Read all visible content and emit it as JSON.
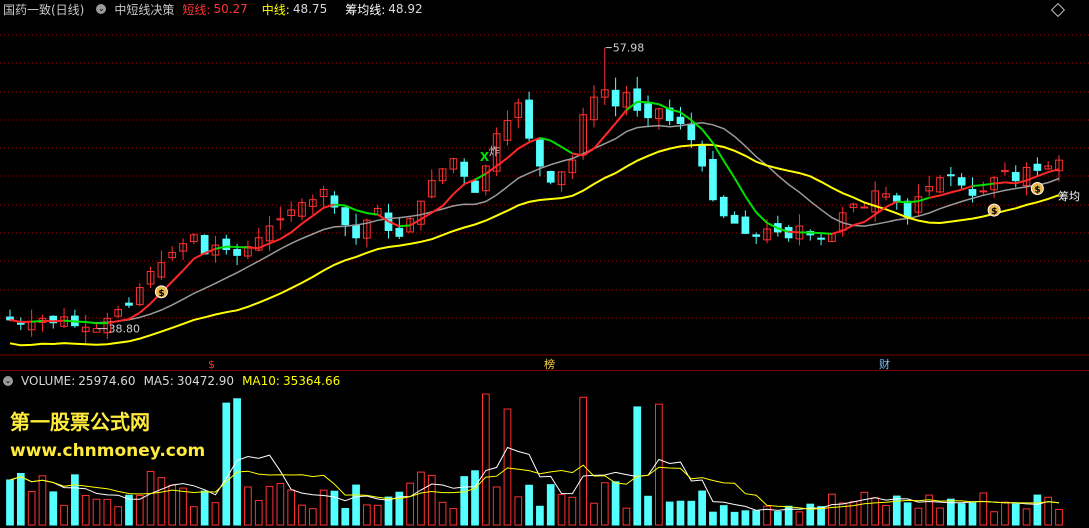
{
  "main_header": {
    "stock": "国药一致(日线)",
    "indicator": "中短线决策",
    "short_label": "短线:",
    "short_value": "50.27",
    "mid_label": "中线:",
    "mid_value": "48.75",
    "chip_label": "筹均线:",
    "chip_value": "48.92"
  },
  "annotations": {
    "high": "57.98",
    "low": "38.80",
    "chip_tag": "筹均",
    "bomb": "炸",
    "cross": "X"
  },
  "bottom_markers": [
    {
      "text": "$",
      "color": "#ff3030"
    },
    {
      "text": "榜",
      "color": "#ffd23c"
    },
    {
      "text": "财",
      "color": "#7ec8ff"
    }
  ],
  "vol_header": {
    "volume_label": "VOLUME:",
    "volume_value": "25974.60",
    "ma5_label": "MA5:",
    "ma5_value": "30472.90",
    "ma10_label": "MA10:",
    "ma10_value": "35364.66"
  },
  "watermark": {
    "title": "第一股票公式网",
    "url": "www.chnmoney.com"
  },
  "colors": {
    "up": "#ff3232",
    "down": "#54ffff",
    "short_line": "#ff2828",
    "mid_line": "#00e000",
    "chip_line": "#ffff00",
    "gray_line": "#9a9a9a",
    "grid": "#a00000"
  },
  "chart_data": {
    "type": "candlestick",
    "ylim": [
      37,
      60
    ],
    "high_label": 57.98,
    "low_label": 38.8,
    "close": [
      39.4,
      39.1,
      39.3,
      39.5,
      39.2,
      39.6,
      39.0,
      38.9,
      38.8,
      39.5,
      40.1,
      40.4,
      41.6,
      42.7,
      43.3,
      44.0,
      44.6,
      45.2,
      43.9,
      44.5,
      44.2,
      43.8,
      44.4,
      45.0,
      45.8,
      46.3,
      46.9,
      47.4,
      47.6,
      48.3,
      47.1,
      45.9,
      45.0,
      46.2,
      47.0,
      45.5,
      45.1,
      46.3,
      47.5,
      48.9,
      49.7,
      50.4,
      49.2,
      48.1,
      49.9,
      52.1,
      53.0,
      54.2,
      51.8,
      49.9,
      48.8,
      49.5,
      50.3,
      53.4,
      54.6,
      55.1,
      54.0,
      54.9,
      53.7,
      53.2,
      53.8,
      53.0,
      52.8,
      51.7,
      49.9,
      47.6,
      46.5,
      46.0,
      45.3,
      45.1,
      45.6,
      45.4,
      45.0,
      45.8,
      45.2,
      44.9,
      45.3,
      46.7,
      47.3,
      47.1,
      48.2,
      48.0,
      47.5,
      46.4,
      47.8,
      48.5,
      49.1,
      49.3,
      48.6,
      47.9,
      48.2,
      49.1,
      49.6,
      48.9,
      49.8,
      49.6,
      49.9,
      50.3
    ]
  }
}
